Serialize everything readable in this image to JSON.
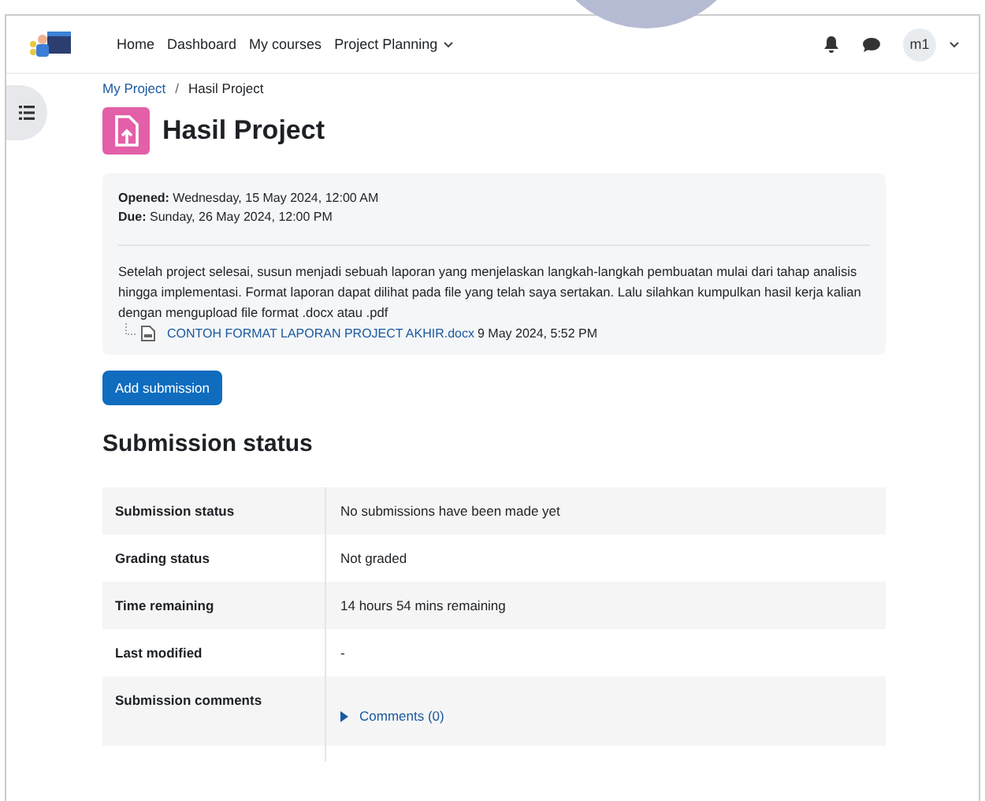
{
  "nav": {
    "items": [
      {
        "label": "Home",
        "dropdown": false
      },
      {
        "label": "Dashboard",
        "dropdown": false
      },
      {
        "label": "My courses",
        "dropdown": false
      },
      {
        "label": "Project Planning",
        "dropdown": true
      }
    ],
    "avatar": "m1"
  },
  "breadcrumb": {
    "items": [
      "My Project",
      "Hasil Project"
    ],
    "separator": "/"
  },
  "title": "Hasil Project",
  "dates": [
    {
      "label": "Opened:",
      "value": "Wednesday, 15 May 2024, 12:00 AM"
    },
    {
      "label": "Due:",
      "value": "Sunday, 26 May 2024, 12:00 PM"
    }
  ],
  "description": "Setelah project selesai, susun menjadi sebuah laporan yang menjelaskan langkah-langkah pembuatan mulai dari tahap analisis hingga implementasi. Format laporan dapat dilihat pada file yang telah saya sertakan. Lalu silahkan kumpulkan hasil kerja kalian dengan mengupload file format .docx atau .pdf",
  "attachment": {
    "name": "CONTOH FORMAT LAPORAN PROJECT AKHIR.docx",
    "date": "9 May 2024, 5:52 PM"
  },
  "button": "Add submission",
  "section_title": "Submission status",
  "table": {
    "rows": [
      {
        "label": "Submission status",
        "value": "No submissions have been made yet",
        "kind": "text"
      },
      {
        "label": "Grading status",
        "value": "Not graded",
        "kind": "text"
      },
      {
        "label": "Time remaining",
        "value": "14 hours 54 mins remaining",
        "kind": "text"
      },
      {
        "label": "Last modified",
        "value": "-",
        "kind": "text"
      },
      {
        "label": "Submission comments",
        "value": "Comments (0)",
        "kind": "link"
      }
    ]
  }
}
